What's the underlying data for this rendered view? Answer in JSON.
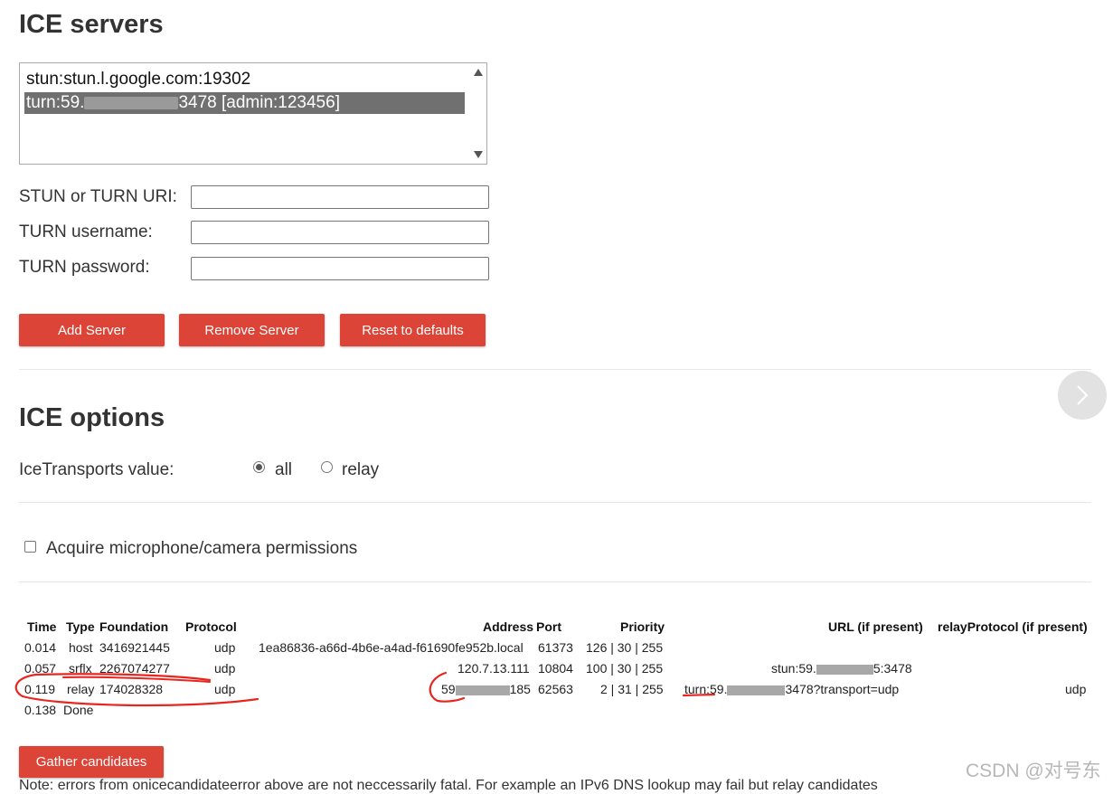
{
  "servers_section": {
    "title": "ICE servers",
    "servers": [
      {
        "text_before": "stun:stun.l.google.com:19302",
        "text_after": ""
      },
      {
        "text_before": "turn:59.",
        "text_after": "3478 [admin:123456]"
      }
    ],
    "fields": {
      "uri_label": "STUN or TURN URI:",
      "username_label": "TURN username:",
      "password_label": "TURN password:"
    },
    "buttons": {
      "add": "Add Server",
      "remove": "Remove Server",
      "reset": "Reset to defaults"
    }
  },
  "options_section": {
    "title": "ICE options",
    "ice_transports_label": "IceTransports value:",
    "radio_all": "all",
    "radio_relay": "relay",
    "checkbox_label": "Acquire microphone/camera permissions"
  },
  "table": {
    "headers": {
      "time": "Time",
      "type": "Type",
      "foundation": "Foundation",
      "protocol": "Protocol",
      "address": "Address",
      "port": "Port",
      "priority": "Priority",
      "url": "URL (if present)",
      "relay_protocol": "relayProtocol (if present)"
    },
    "rows": [
      {
        "time": "0.014",
        "type": "host",
        "foundation": "3416921445",
        "protocol": "udp",
        "address": "1ea86836-a66d-4b6e-a4ad-f61690fe952b.local",
        "port": "61373",
        "priority": "126 | 30 | 255",
        "url": "",
        "relay": ""
      },
      {
        "time": "0.057",
        "type": "srflx",
        "foundation": "2267074277",
        "protocol": "udp",
        "address": "120.7.13.111",
        "port": "10804",
        "priority": "100 | 30 | 255",
        "url_a": "stun:59.",
        "url_b": "5:3478",
        "relay": ""
      },
      {
        "time": "0.119",
        "type": "relay",
        "foundation": "174028328",
        "protocol": "udp",
        "address_a": "59",
        "address_b": "185",
        "port": "62563",
        "priority": "2 | 31 | 255",
        "url_a": "turn:59.",
        "url_b": "3478?transport=udp",
        "relay": "udp"
      }
    ],
    "done_time": "0.138",
    "done_text": "Done"
  },
  "gather_button": "Gather candidates",
  "note_text": "Note: errors from onicecandidateerror above are not neccessarily fatal. For example an IPv6 DNS lookup may fail but relay candidates",
  "watermark": "CSDN @对号东",
  "colors": {
    "button": "#db4437",
    "annotation": "#e8251e"
  }
}
